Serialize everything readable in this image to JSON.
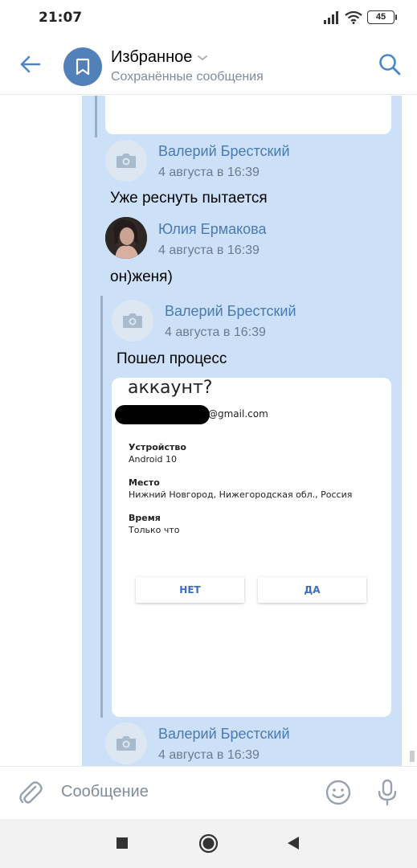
{
  "status_bar": {
    "time": "21:07",
    "battery": "45"
  },
  "header": {
    "title": "Избранное",
    "subtitle": "Сохранённые сообщения"
  },
  "messages": [
    {
      "author": "Валерий Брестский",
      "date": "4 августа в 16:39",
      "text": "Уже реснуть пытается",
      "avatar": "camera-placeholder"
    },
    {
      "author": "Юлия Ермакова",
      "date": "4 августа в 16:39",
      "text": "он)женя)",
      "avatar": "photo"
    },
    {
      "author": "Валерий Брестский",
      "date": "4 августа в 16:39",
      "text": "Пошел процесс",
      "avatar": "camera-placeholder",
      "screenshot": {
        "heading": "аккаунт?",
        "email": "@gmail.com",
        "device_label": "Устройство",
        "device_value": "Android 10",
        "place_label": "Место",
        "place_value": "Нижний Новгород, Нижегородская обл., Россия",
        "time_label": "Время",
        "time_value": "Только что",
        "no_button": "НЕТ",
        "yes_button": "ДА"
      }
    },
    {
      "author": "Валерий Брестский",
      "date": "4 августа в 16:39",
      "avatar": "camera-placeholder"
    }
  ],
  "composer": {
    "placeholder": "Сообщение"
  },
  "colors": {
    "accent": "#4a86c8",
    "forward_bg": "#cce1f7",
    "avatar_bg": "#5181b8"
  }
}
